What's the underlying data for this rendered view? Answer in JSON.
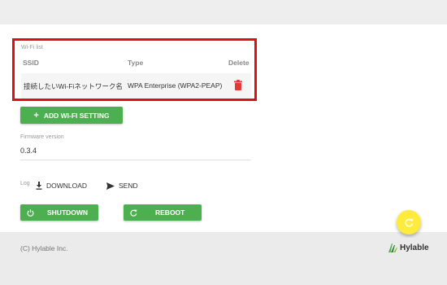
{
  "wifi": {
    "caption": "Wi-Fi list",
    "headers": {
      "ssid": "SSID",
      "type": "Type",
      "delete": "Delete"
    },
    "rows": [
      {
        "ssid": "接続したいWi-Fiネットワーク名",
        "type": "WPA Enterprise (WPA2-PEAP)",
        "delete_icon": "trash-icon"
      }
    ],
    "highlight_color": "#e01010",
    "delete_icon_color": "#e53935"
  },
  "actions": {
    "add_wifi": "ADD WI-FI SETTING",
    "add_icon": "plus-icon"
  },
  "firmware": {
    "caption": "Firmware version",
    "value": "0.3.4"
  },
  "log": {
    "caption": "Log",
    "download": "DOWNLOAD",
    "send": "SEND"
  },
  "system": {
    "shutdown": "SHUTDOWN",
    "reboot": "REBOOT"
  },
  "fab": {
    "icon": "refresh-icon",
    "color": "#ffeb3b"
  },
  "footer": {
    "copyright": "(C) Hylable Inc.",
    "logo": "Hylable"
  },
  "colors": {
    "primary": "#4caf50"
  }
}
